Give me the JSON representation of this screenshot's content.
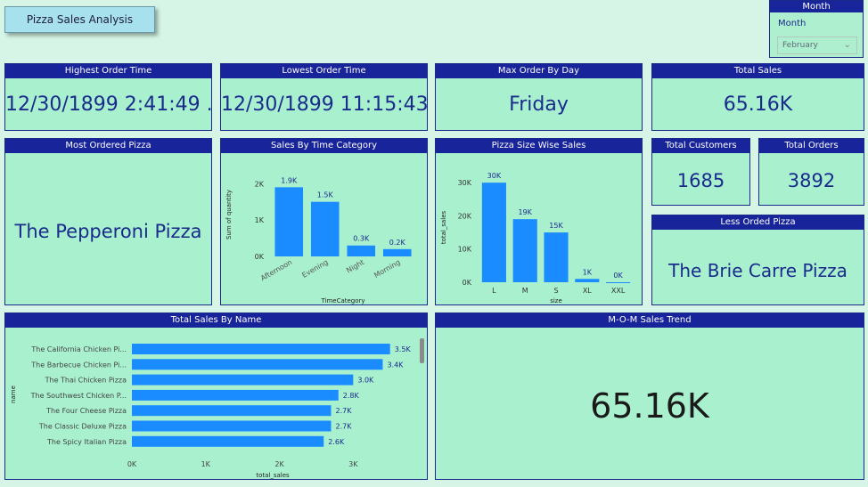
{
  "report_title": "Pizza Sales Analysis",
  "slicer": {
    "header": "Month",
    "label": "Month",
    "selected": "February"
  },
  "colors": {
    "header_bg": "#18249a",
    "card_bg": "#a9f0cf",
    "bar": "#1a8cff",
    "kpi_text": "#1a2b8c"
  },
  "cards": {
    "highest_order_time": {
      "title": "Highest Order Time",
      "value": "12/30/1899 2:41:49 ..."
    },
    "lowest_order_time": {
      "title": "Lowest Order Time",
      "value": "12/30/1899 11:15:43..."
    },
    "max_order_by_day": {
      "title": "Max Order By Day",
      "value": "Friday"
    },
    "total_sales": {
      "title": "Total Sales",
      "value": "65.16K"
    },
    "most_ordered_pizza": {
      "title": "Most Ordered Pizza",
      "value": "The Pepperoni Pizza"
    },
    "total_customers": {
      "title": "Total Customers",
      "value": "1685"
    },
    "total_orders": {
      "title": "Total Orders",
      "value": "3892"
    },
    "less_ordered_pizza": {
      "title": "Less Orded Pizza",
      "value": "The Brie Carre Pizza"
    },
    "mom_sales_trend": {
      "title": "M-O-M Sales Trend",
      "value": "65.16K"
    }
  },
  "chart_data": [
    {
      "id": "time_category",
      "type": "bar",
      "title": "Sales By Time Category",
      "xlabel": "TimeCategory",
      "ylabel": "Sum of quantity",
      "categories": [
        "Afternoon",
        "Evening",
        "Night",
        "Morning"
      ],
      "values": [
        1900,
        1500,
        300,
        200
      ],
      "data_labels": [
        "1.9K",
        "1.5K",
        "0.3K",
        "0.2K"
      ],
      "yticks": [
        0,
        1000,
        2000
      ],
      "ytick_labels": [
        "0K",
        "1K",
        "2K"
      ],
      "ylim": [
        0,
        2300
      ]
    },
    {
      "id": "size",
      "type": "bar",
      "title": "Pizza Size Wise Sales",
      "xlabel": "size",
      "ylabel": "total_sales",
      "categories": [
        "L",
        "M",
        "S",
        "XL",
        "XXL"
      ],
      "values": [
        30000,
        19000,
        15000,
        1000,
        0
      ],
      "data_labels": [
        "30K",
        "19K",
        "15K",
        "1K",
        "0K"
      ],
      "yticks": [
        0,
        10000,
        20000,
        30000
      ],
      "ytick_labels": [
        "0K",
        "10K",
        "20K",
        "30K"
      ],
      "ylim": [
        0,
        33000
      ]
    },
    {
      "id": "by_name",
      "type": "bar",
      "orientation": "horizontal",
      "title": "Total Sales By Name",
      "xlabel": "total_sales",
      "ylabel": "name",
      "categories": [
        "The California Chicken Pi...",
        "The Barbecue Chicken Pi...",
        "The Thai Chicken Pizza",
        "The Southwest Chicken P...",
        "The Four Cheese Pizza",
        "The Classic Deluxe Pizza",
        "The Spicy Italian Pizza"
      ],
      "values": [
        3500,
        3400,
        3000,
        2800,
        2700,
        2700,
        2600
      ],
      "data_labels": [
        "3.5K",
        "3.4K",
        "3.0K",
        "2.8K",
        "2.7K",
        "2.7K",
        "2.6K"
      ],
      "xticks": [
        0,
        1000,
        2000,
        3000
      ],
      "xtick_labels": [
        "0K",
        "1K",
        "2K",
        "3K"
      ],
      "xlim": [
        0,
        3600
      ]
    }
  ]
}
